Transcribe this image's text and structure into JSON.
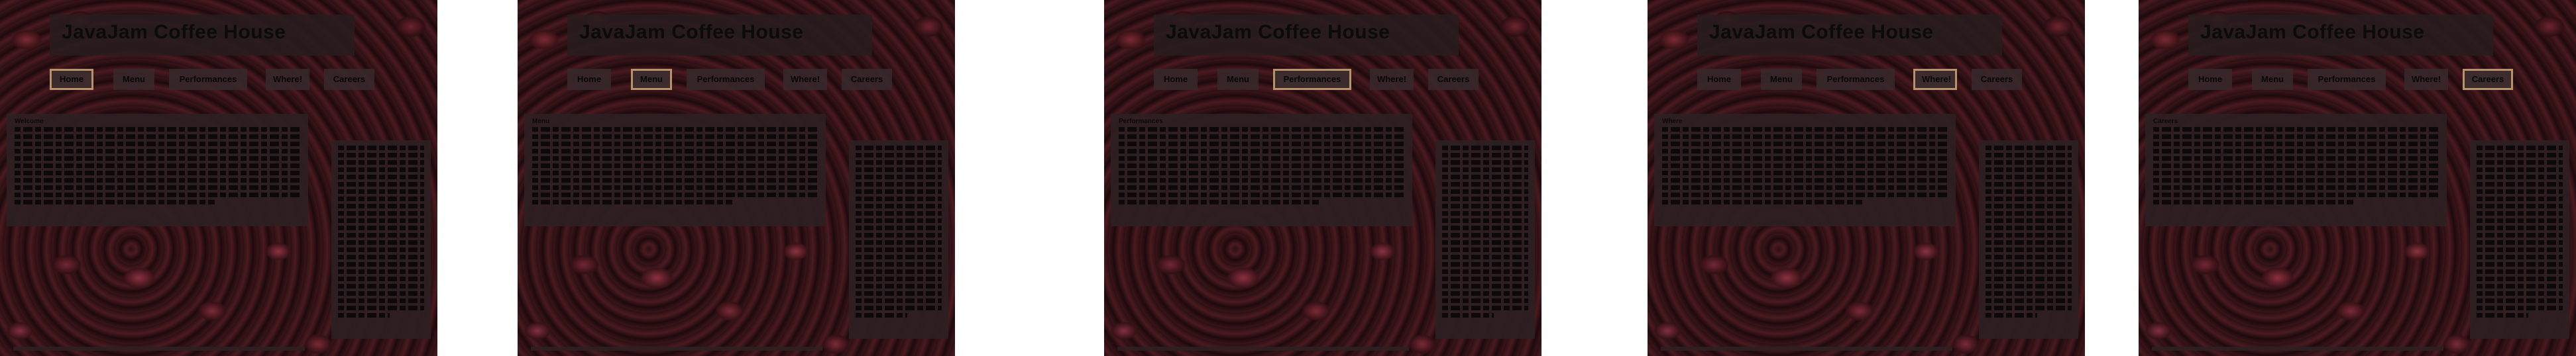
{
  "site": {
    "title": "JavaJam Coffee House"
  },
  "nav": {
    "items": [
      {
        "key": "home",
        "label": "Home"
      },
      {
        "key": "menu",
        "label": "Menu"
      },
      {
        "key": "performances",
        "label": "Performances"
      },
      {
        "key": "where",
        "label": "Where!"
      },
      {
        "key": "careers",
        "label": "Careers"
      }
    ]
  },
  "screens": [
    {
      "active": "home",
      "lead_word": "Welcome"
    },
    {
      "active": "menu",
      "lead_word": "Menu"
    },
    {
      "active": "performances",
      "lead_word": "Performances"
    },
    {
      "active": "where",
      "lead_word": "Where"
    },
    {
      "active": "careers",
      "lead_word": "Careers"
    }
  ],
  "theme": {
    "active_border": "#b7926a",
    "panel_bg": "#2d2022",
    "text": "#0b0809"
  }
}
